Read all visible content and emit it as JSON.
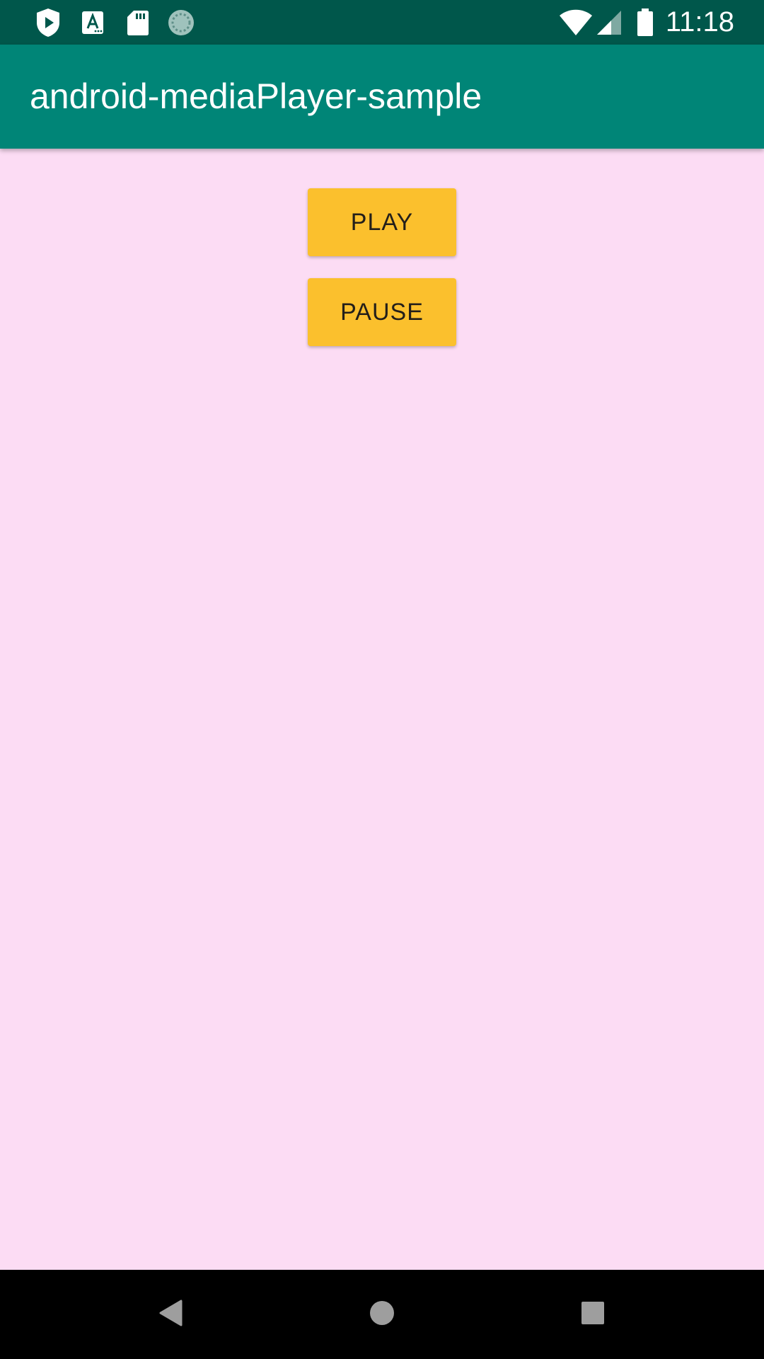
{
  "status_bar": {
    "time": "11:18",
    "left_icons": [
      "play-protect-icon",
      "font-a-icon",
      "sd-card-icon",
      "sync-spinner-icon"
    ],
    "right_icons": [
      "wifi-icon",
      "cellular-signal-icon",
      "battery-icon"
    ],
    "color": "#00574b"
  },
  "toolbar": {
    "title": "android-mediaPlayer-sample",
    "color": "#008577"
  },
  "content": {
    "background": "#fcdcf4",
    "play_label": "PLAY",
    "pause_label": "PAUSE",
    "button_color": "#fbc02d"
  },
  "nav_bar": {
    "icons": [
      "back-icon",
      "home-icon",
      "recents-icon"
    ]
  }
}
